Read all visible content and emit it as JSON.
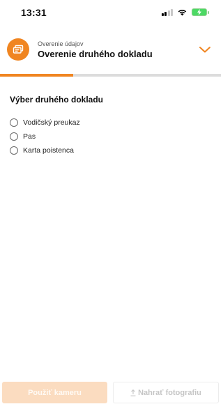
{
  "status_bar": {
    "time": "13:31",
    "icons": [
      "cellular-signal-icon",
      "wifi-icon",
      "battery-charging-icon"
    ]
  },
  "header": {
    "icon": "documents-icon",
    "subtitle": "Overenie údajov",
    "title": "Overenie druhého dokladu",
    "chevron_icon": "chevron-down-icon"
  },
  "progress": {
    "fraction": 0.33
  },
  "form": {
    "section_title": "Výber druhého dokladu",
    "options": [
      {
        "label": "Vodičský preukaz",
        "selected": false
      },
      {
        "label": "Pas",
        "selected": false
      },
      {
        "label": "Karta poistenca",
        "selected": false
      }
    ]
  },
  "actions": {
    "camera_label": "Použiť kameru",
    "upload_label": "Nahrať fotografiu",
    "upload_icon": "upload-icon",
    "enabled": false
  },
  "colors": {
    "accent": "#f08521",
    "accent_disabled": "#fbdcc0",
    "track": "#dcdcdc"
  }
}
